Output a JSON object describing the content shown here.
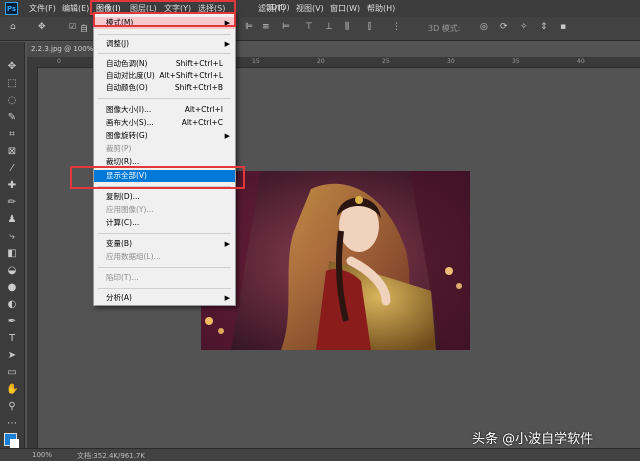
{
  "app": {
    "logo": "Ps"
  },
  "menubar": {
    "items": [
      {
        "label": "文件(F)"
      },
      {
        "label": "编辑(E)"
      },
      {
        "label": "图像(I)"
      },
      {
        "label": "图层(L)"
      },
      {
        "label": "文字(Y)"
      },
      {
        "label": "选择(S)"
      },
      {
        "label": "滤镜(T)"
      },
      {
        "label": "3D(D)"
      },
      {
        "label": "视图(V)"
      },
      {
        "label": "窗口(W)"
      },
      {
        "label": "帮助(H)"
      }
    ]
  },
  "options": {
    "auto_select_label": "自",
    "mode_3d_label": "3D 模式:"
  },
  "document": {
    "tab_label": "2.2.3.jpg @ 100%"
  },
  "ruler": {
    "ticks": [
      "0",
      "5",
      "10",
      "15",
      "20",
      "25",
      "30",
      "35",
      "40"
    ]
  },
  "image_menu": {
    "items": [
      {
        "label": "模式(M)",
        "shortcut": "",
        "submenu": true,
        "disabled": false
      },
      {
        "label": "调整(J)",
        "shortcut": "",
        "submenu": true,
        "disabled": false
      },
      {
        "label": "自动色调(N)",
        "shortcut": "Shift+Ctrl+L",
        "submenu": false,
        "disabled": false
      },
      {
        "label": "自动对比度(U)",
        "shortcut": "Alt+Shift+Ctrl+L",
        "submenu": false,
        "disabled": false
      },
      {
        "label": "自动颜色(O)",
        "shortcut": "Shift+Ctrl+B",
        "submenu": false,
        "disabled": false
      },
      {
        "label": "图像大小(I)...",
        "shortcut": "Alt+Ctrl+I",
        "submenu": false,
        "disabled": false
      },
      {
        "label": "画布大小(S)...",
        "shortcut": "Alt+Ctrl+C",
        "submenu": false,
        "disabled": false
      },
      {
        "label": "图像旋转(G)",
        "shortcut": "",
        "submenu": true,
        "disabled": false
      },
      {
        "label": "裁剪(P)",
        "shortcut": "",
        "submenu": false,
        "disabled": true
      },
      {
        "label": "裁切(R)...",
        "shortcut": "",
        "submenu": false,
        "disabled": false
      },
      {
        "label": "显示全部(V)",
        "shortcut": "",
        "submenu": false,
        "disabled": false
      },
      {
        "label": "复制(D)...",
        "shortcut": "",
        "submenu": false,
        "disabled": false
      },
      {
        "label": "应用图像(Y)...",
        "shortcut": "",
        "submenu": false,
        "disabled": true
      },
      {
        "label": "计算(C)...",
        "shortcut": "",
        "submenu": false,
        "disabled": false
      },
      {
        "label": "变量(B)",
        "shortcut": "",
        "submenu": true,
        "disabled": false
      },
      {
        "label": "应用数据组(L)...",
        "shortcut": "",
        "submenu": false,
        "disabled": true
      },
      {
        "label": "陷印(T)...",
        "shortcut": "",
        "submenu": false,
        "disabled": true
      },
      {
        "label": "分析(A)",
        "shortcut": "",
        "submenu": true,
        "disabled": false
      }
    ]
  },
  "status": {
    "zoom": "100%",
    "doc_info": "文档:352.4K/961.7K"
  },
  "watermark": {
    "text": "头条 @小波自学软件"
  },
  "colors": {
    "highlight": "#e0383b",
    "selection": "#0078d7",
    "foreground": "#1a7fd6",
    "background": "#ffffff"
  }
}
